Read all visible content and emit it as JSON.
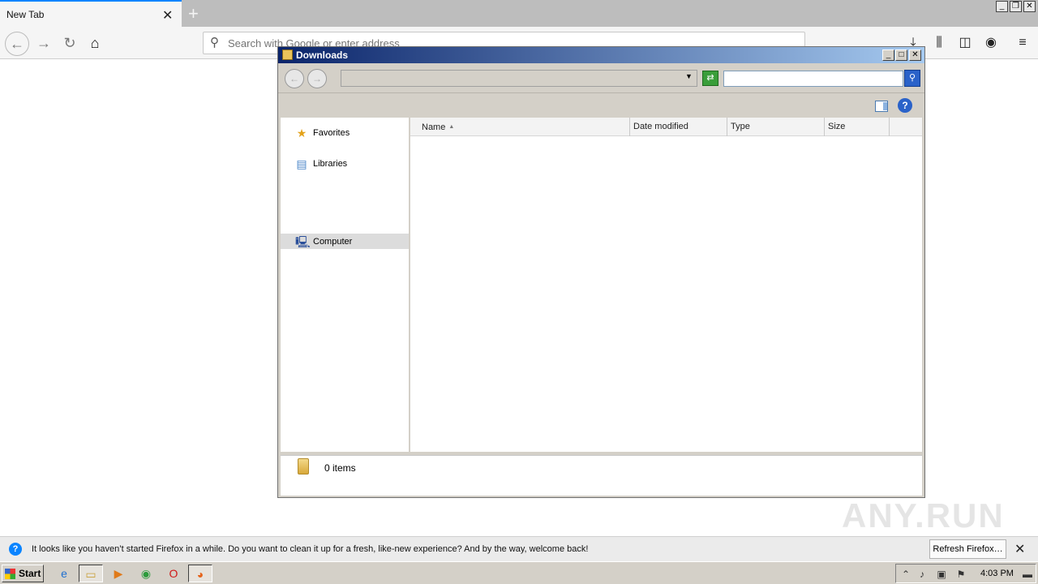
{
  "browser": {
    "tab_title": "New Tab",
    "url_placeholder": "Search with Google or enter address",
    "icons": {
      "back": "arrow-left-icon",
      "forward": "arrow-right-icon",
      "reload": "reload-icon",
      "home": "home-icon",
      "downloads": "download-icon",
      "library": "library-icon",
      "sidebar": "sidebar-icon",
      "account": "account-icon",
      "menu": "hamburger-menu-icon"
    }
  },
  "downloads_window": {
    "title": "Downloads",
    "search_placeholder": "",
    "nav": {
      "favorites": "Favorites",
      "libraries": "Libraries",
      "computer": "Computer"
    },
    "columns": {
      "name": "Name",
      "date_modified": "Date modified",
      "type": "Type",
      "size": "Size"
    },
    "status": "0 items"
  },
  "notification": {
    "text": "It looks like you haven’t started Firefox in a while. Do you want to clean it up for a fresh, like-new experience? And by the way, welcome back!",
    "button": "Refresh Firefox…"
  },
  "taskbar": {
    "start": "Start",
    "clock": "4:03 PM"
  },
  "watermark": "ANY.RUN",
  "colors": {
    "accent": "#0a84ff",
    "titlebar_start": "#0a246a",
    "titlebar_end": "#a6caf0"
  }
}
